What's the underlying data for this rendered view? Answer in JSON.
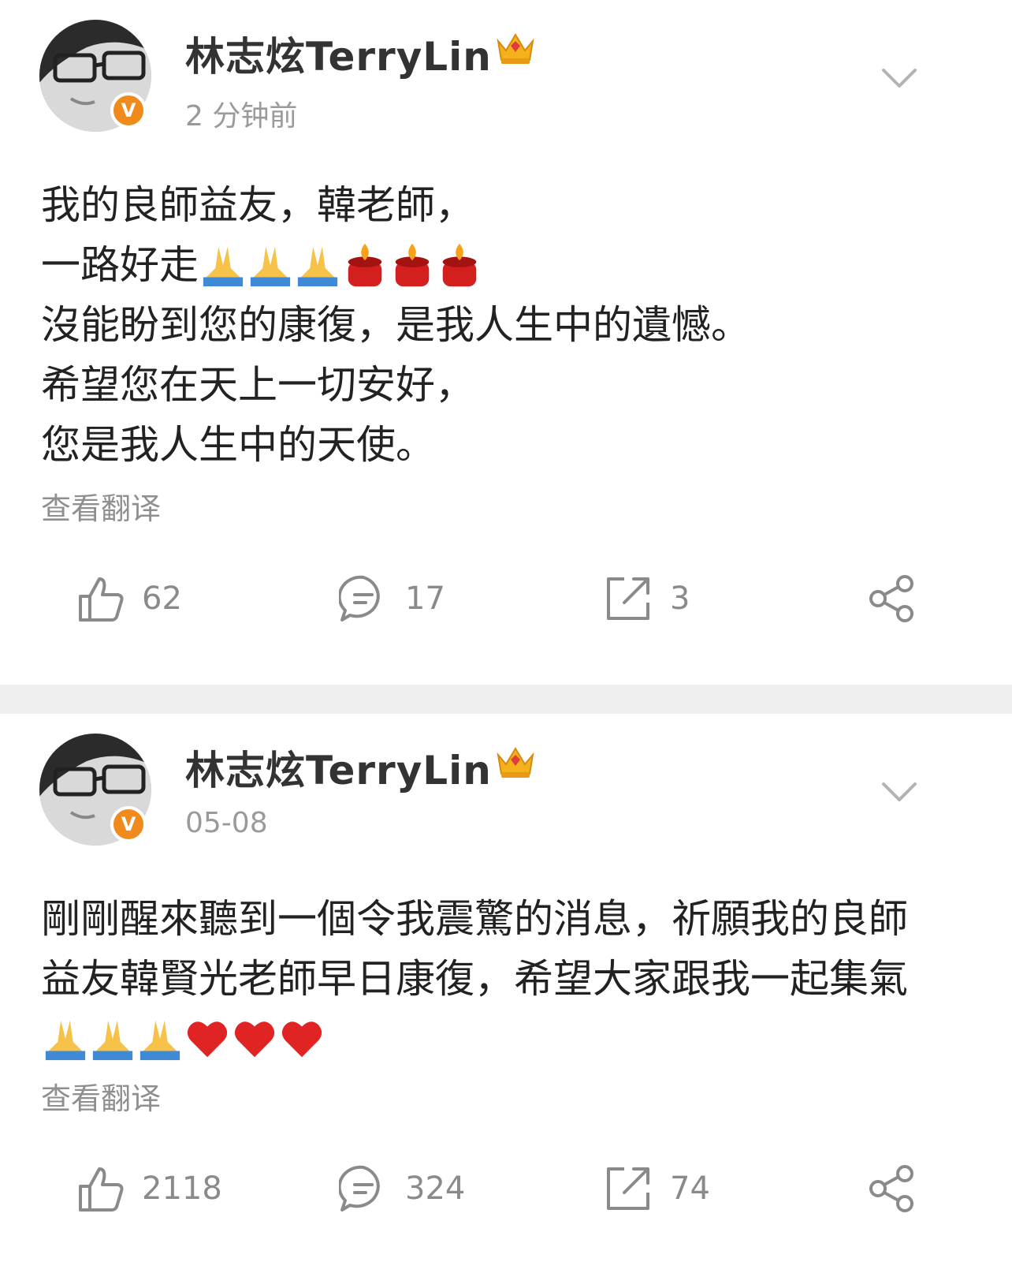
{
  "posts": [
    {
      "username": "林志炫TerryLin",
      "time": "2 分钟前",
      "lines": [
        "我的良師益友，韓老師，",
        "一路好走",
        "沒能盼到您的康復，是我人生中的遺憾。",
        "希望您在天上一切安好，",
        "您是我人生中的天使。"
      ],
      "translate": "查看翻译",
      "likes": "62",
      "comments": "17",
      "reposts": "3"
    },
    {
      "username": "林志炫TerryLin",
      "time": "05-08",
      "lines": [
        "剛剛醒來聽到一個令我震驚的消息，祈願我的良師",
        "益友韓賢光老師早日康復，希望大家跟我一起集氣"
      ],
      "translate": "查看翻译",
      "likes": "2118",
      "comments": "324",
      "reposts": "74"
    }
  ],
  "icons": {
    "verified": "V",
    "crown": "crown-icon",
    "pray": "folded-hands-emoji",
    "candle": "candle-emoji",
    "heart": "red-heart-emoji"
  },
  "colors": {
    "verified_badge": "#f08a1c",
    "muted_text": "#8a8a8a",
    "divider": "#efefef"
  }
}
